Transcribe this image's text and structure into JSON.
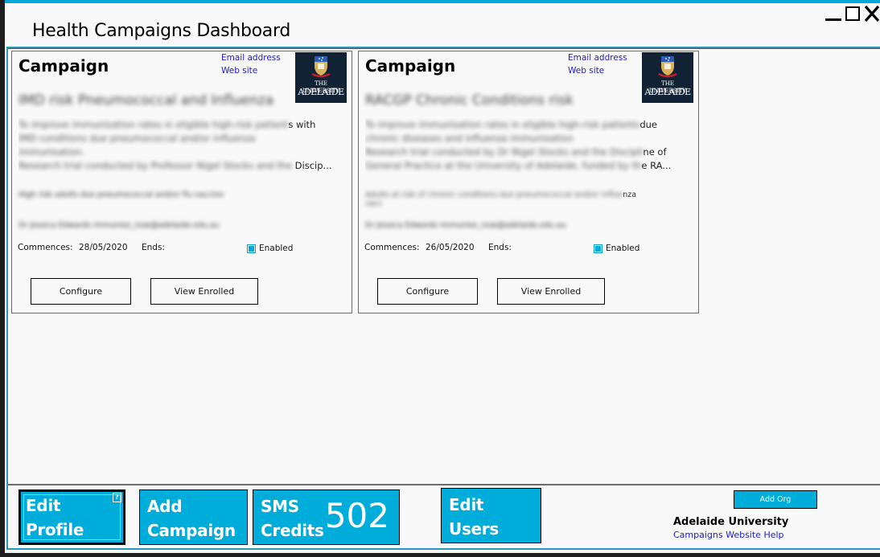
{
  "window": {
    "title": "Health Campaigns Dashboard",
    "controls": [
      "minimize-icon",
      "maximize-icon",
      "close-icon"
    ],
    "accent_color": "#00a9d9"
  },
  "campaigns": [
    {
      "heading": "Campaign",
      "email_link": "Email address",
      "website_link": "Web site",
      "logo": {
        "line1": "THE UNIVERSITY",
        "line2": "ADELAIDE"
      },
      "title": "IMD risk Pneumococcal and Influenza",
      "description_lines": [
        {
          "blurred": "To improve immunisation rates in eligible high-risk patient",
          "clear": "s with"
        },
        {
          "blurred": "IMD conditions due pneumococcal and/or influenza",
          "clear": ""
        },
        {
          "blurred": "immunisation.",
          "clear": ""
        },
        {
          "blurred": "Research trial conducted by Professor Nigel Stocks and the",
          "clear": " Discip..."
        }
      ],
      "target": "High risk adults due pneumococcal and/or flu vaccine",
      "contact": "Dr Jessica Edwards immunise_now@adelaide.edu.au",
      "commences_label": "Commences:",
      "commences": "28/05/2020",
      "ends_label": "Ends:",
      "ends": "",
      "enabled_label": "Enabled",
      "enabled": true,
      "configure_label": "Configure",
      "view_enrolled_label": "View Enrolled"
    },
    {
      "heading": "Campaign",
      "email_link": "Email address",
      "website_link": "Web site",
      "logo": {
        "line1": "THE UNIVERSITY",
        "line2": "ADELAIDE"
      },
      "title": "RACGP Chronic Conditions risk",
      "description_lines": [
        {
          "blurred": "To improve immunisation rates in eligible high-risk patients",
          "clear": "due"
        },
        {
          "blurred": "chronic diseases and influenza immunisation",
          "clear": ""
        },
        {
          "blurred": "Research trial conducted by Dr Nigel Stocks and the Discipli",
          "clear": "ne of"
        },
        {
          "blurred": "General Practice at the University of Adelaide, funded by th",
          "clear": "e RA..."
        }
      ],
      "target": "Adults at risk of chronic conditions due pneumococcal and/or influe",
      "target_clear": "nza",
      "target_line2": "vacc",
      "contact": "Dr Jessica Edwards immunise_now@adelaide.edu.au",
      "commences_label": "Commences:",
      "commences": "26/05/2020",
      "ends_label": "Ends:",
      "ends": "",
      "enabled_label": "Enabled",
      "enabled": true,
      "configure_label": "Configure",
      "view_enrolled_label": "View Enrolled"
    }
  ],
  "footer": {
    "edit_profile": "Edit\nProfile",
    "help_badge": "?",
    "add_campaign": "Add\nCampaign",
    "sms_credits": "SMS\nCredits",
    "sms_count": "502",
    "edit_users": "Edit\nUsers",
    "add_org": "Add Org",
    "org_name": "Adelaide University",
    "help_link": "Campaigns Website Help",
    "tile_color": "#00acd9"
  }
}
